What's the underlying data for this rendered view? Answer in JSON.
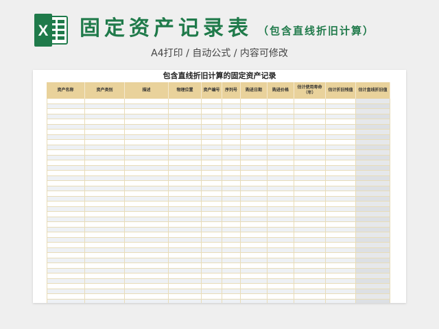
{
  "banner": {
    "logo_letter": "X",
    "title": "固定资产记录表",
    "subtitle": "（包含直线折旧计算）",
    "features": "A4打印 / 自动公式 / 内容可修改",
    "brand_color": "#1f7a4a"
  },
  "sheet": {
    "title": "包含直线折旧计算的固定资产记录",
    "header_color": "#e9d29b",
    "columns": [
      "资产名称",
      "资产类别",
      "描述",
      "物理位置",
      "资产编号",
      "序列号",
      "购进日期",
      "购进价格",
      "估计使用寿命\n（年）",
      "估计折旧残值",
      "估计直线折旧值"
    ],
    "empty_row_count": 40
  }
}
